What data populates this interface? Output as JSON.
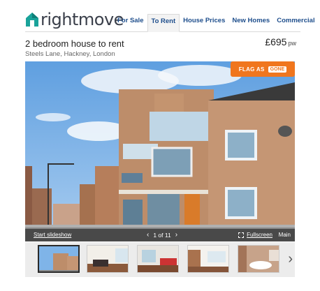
{
  "brand": {
    "logo_text": "rightmove",
    "color": "#1aa39a"
  },
  "nav": {
    "items": [
      {
        "label": "For Sale",
        "active": false
      },
      {
        "label": "To Rent",
        "active": true
      },
      {
        "label": "House Prices",
        "active": false
      },
      {
        "label": "New Homes",
        "active": false
      },
      {
        "label": "Commercial",
        "active": false
      }
    ]
  },
  "listing": {
    "title": "2 bedroom house to rent",
    "address": "Steels Lane, Hackney, London",
    "price": "£695",
    "price_unit": "pw"
  },
  "photo": {
    "flag_label": "FLAG AS",
    "flag_badge": "GONE",
    "slideshow_label": "Start slideshow",
    "counter": "1 of 11",
    "prev_icon": "chevron-left-icon",
    "next_icon": "chevron-right-icon",
    "fullscreen_label": "Fullscreen",
    "main_label": "Main"
  },
  "thumbnails": {
    "count": 6,
    "selected_index": 0,
    "next_icon": "chevron-right-icon"
  },
  "colors": {
    "nav_text": "#1e4e8c",
    "flag_orange": "#f0761e",
    "sky": "#7fb4e8",
    "brick": "#b98a6a"
  }
}
